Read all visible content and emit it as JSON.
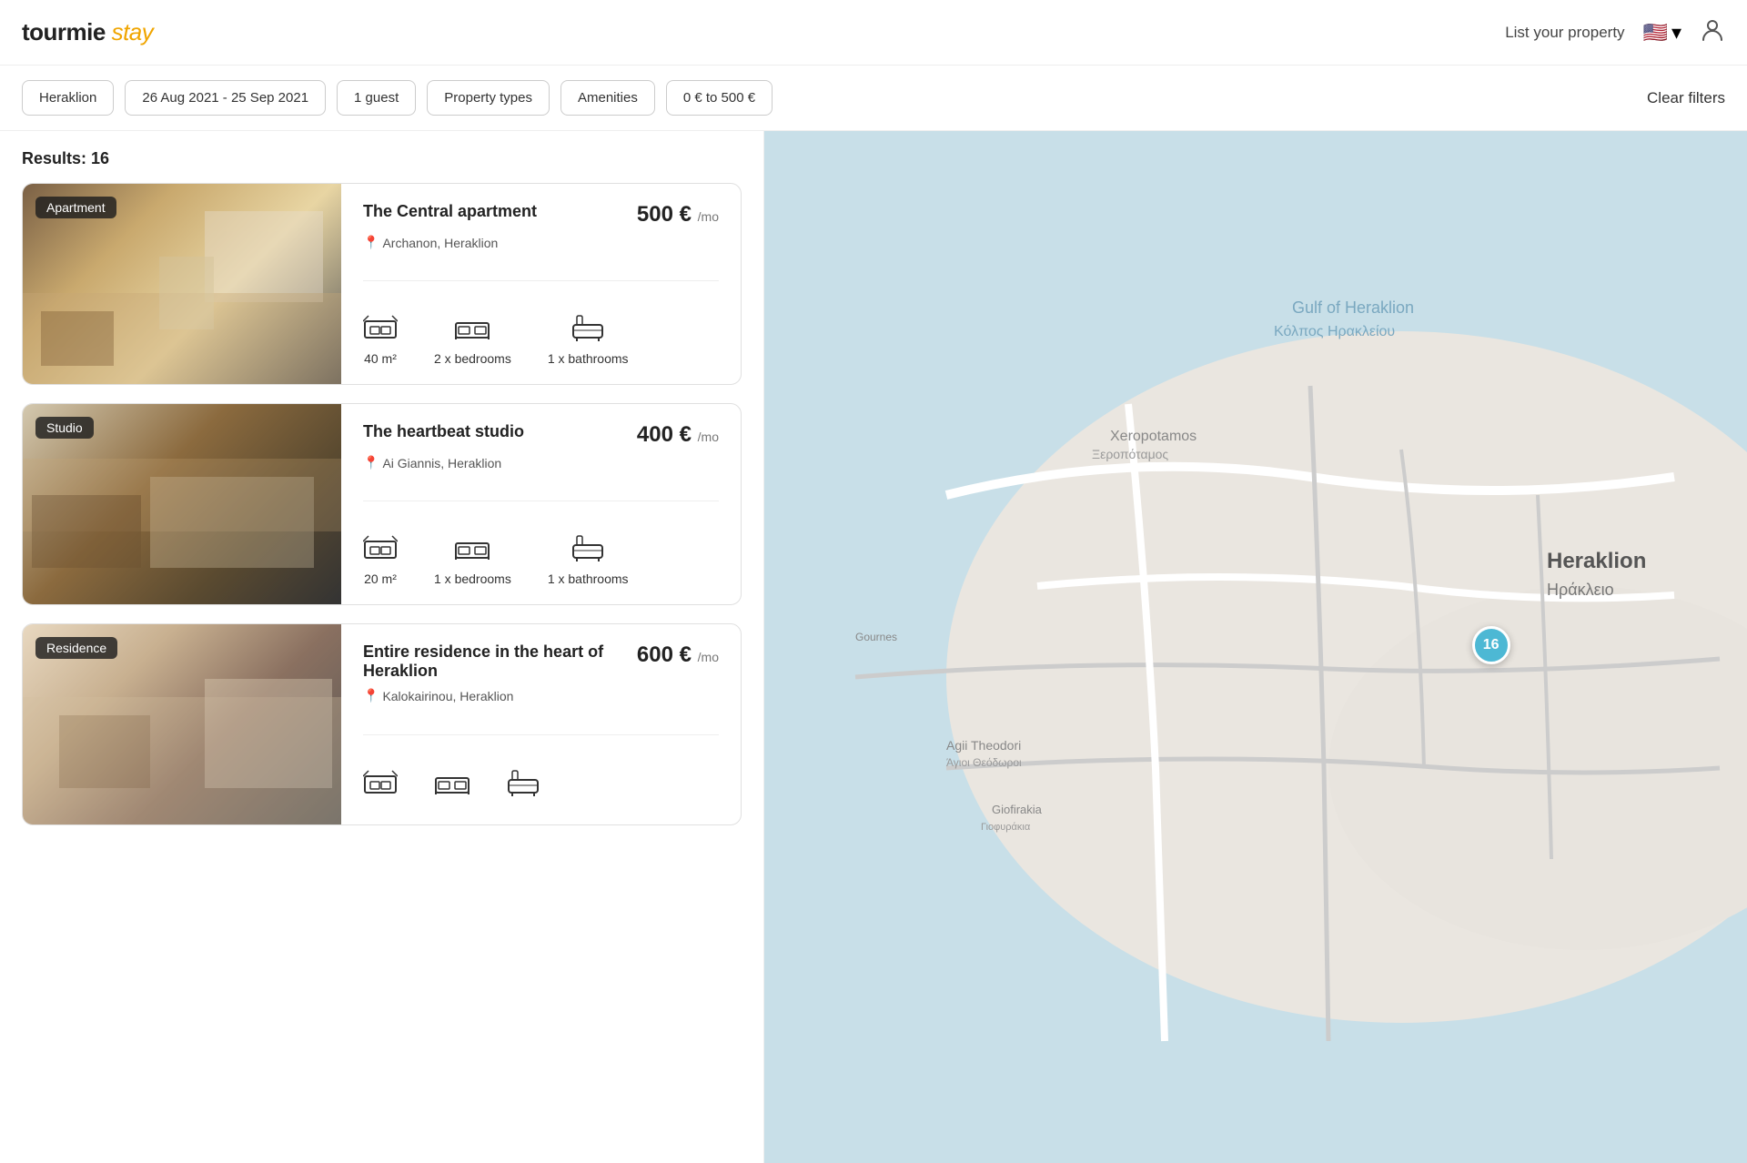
{
  "header": {
    "logo_text": "tourmie",
    "logo_italic": "stay",
    "list_property": "List your property",
    "flag_emoji": "🇺🇸",
    "flag_chevron": "▾"
  },
  "filters": {
    "location": "Heraklion",
    "dates": "26 Aug 2021 - 25 Sep 2021",
    "guests": "1 guest",
    "property_types": "Property types",
    "amenities": "Amenities",
    "price_range": "0 € to 500 €",
    "clear": "Clear filters"
  },
  "results": {
    "label": "Results:",
    "count": "16"
  },
  "properties": [
    {
      "id": 1,
      "type": "Apartment",
      "title": "The Central apartment",
      "location": "Archanon, Heraklion",
      "price": "500",
      "currency": "€",
      "per": "/mo",
      "area": "40 m²",
      "bedrooms": "2 x bedrooms",
      "bathrooms": "1 x bathrooms"
    },
    {
      "id": 2,
      "type": "Studio",
      "title": "The heartbeat studio",
      "location": "Ai Giannis, Heraklion",
      "price": "400",
      "currency": "€",
      "per": "/mo",
      "area": "20 m²",
      "bedrooms": "1 x bedrooms",
      "bathrooms": "1 x bathrooms"
    },
    {
      "id": 3,
      "type": "Residence",
      "title": "Entire residence in the heart of Heraklion",
      "location": "Kalokairinou, Heraklion",
      "price": "600",
      "currency": "€",
      "per": "/mo",
      "area": "—",
      "bedrooms": "—",
      "bathrooms": "—"
    }
  ],
  "map": {
    "cluster_count": "16",
    "cluster_top": "48%",
    "cluster_left": "72%"
  }
}
